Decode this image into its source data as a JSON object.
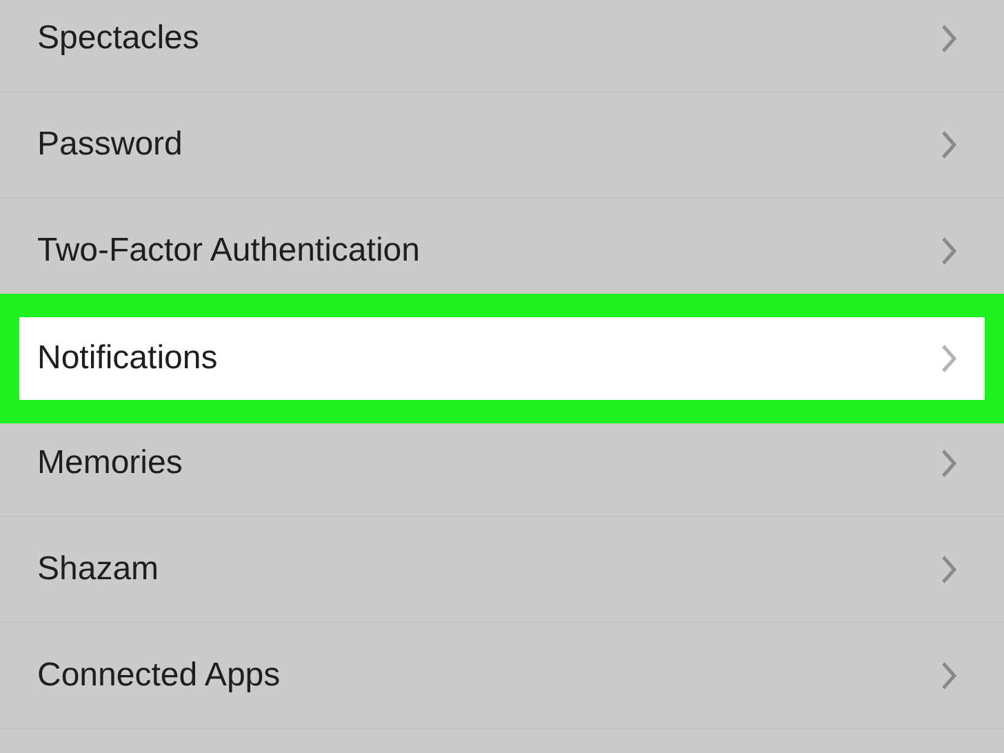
{
  "settings_list": [
    {
      "label": "Spectacles",
      "selected": false
    },
    {
      "label": "Password",
      "selected": false
    },
    {
      "label": "Two-Factor Authentication",
      "selected": false
    },
    {
      "label": "Notifications",
      "selected": true
    },
    {
      "label": "Memories",
      "selected": false
    },
    {
      "label": "Shazam",
      "selected": false
    },
    {
      "label": "Connected Apps",
      "selected": false
    }
  ]
}
